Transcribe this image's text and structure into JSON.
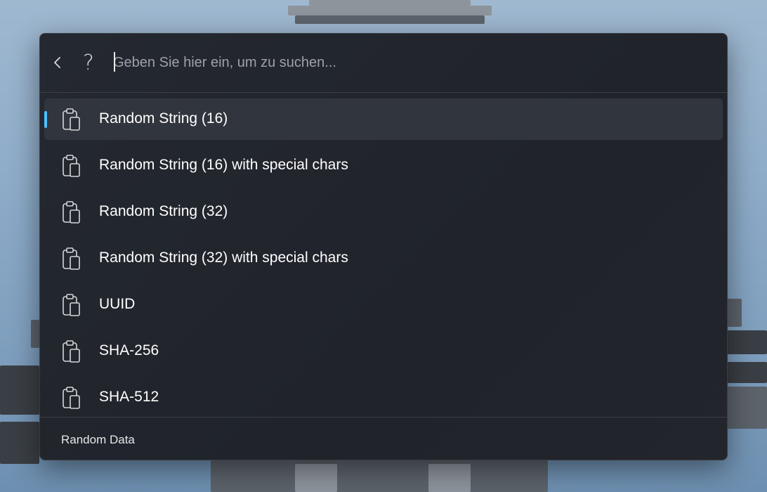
{
  "search": {
    "placeholder": "Geben Sie hier ein, um zu suchen..."
  },
  "toolbar": {
    "back_icon": "chevron-left-icon",
    "help_label": "?"
  },
  "results": [
    {
      "label": "Random String (16)",
      "icon": "clipboard-icon",
      "selected": true
    },
    {
      "label": "Random String (16) with special chars",
      "icon": "clipboard-icon",
      "selected": false
    },
    {
      "label": "Random String (32)",
      "icon": "clipboard-icon",
      "selected": false
    },
    {
      "label": "Random String (32) with special chars",
      "icon": "clipboard-icon",
      "selected": false
    },
    {
      "label": "UUID",
      "icon": "clipboard-icon",
      "selected": false
    },
    {
      "label": "SHA-256",
      "icon": "clipboard-icon",
      "selected": false
    },
    {
      "label": "SHA-512",
      "icon": "clipboard-icon",
      "selected": false
    }
  ],
  "footer": {
    "title": "Random Data"
  },
  "colors": {
    "accent": "#4cc2ff",
    "panel_bg": "#22252c",
    "selected_bg": "#31353d",
    "text": "#ffffff"
  }
}
